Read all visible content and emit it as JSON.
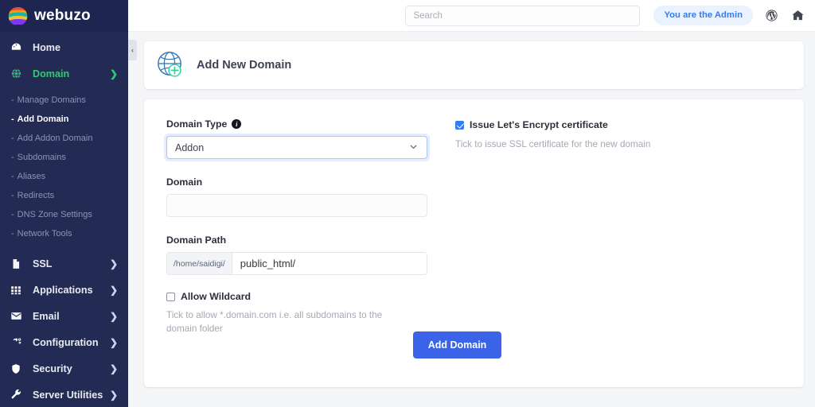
{
  "brand": {
    "name": "webuzo",
    "logo_icon": "webuzo-globe-logo"
  },
  "sidebar": {
    "primary": [
      {
        "label": "Home",
        "icon": "dashboard-gauge-icon",
        "has_chevron": false,
        "active": false
      },
      {
        "label": "Domain",
        "icon": "globe-icon",
        "has_chevron": true,
        "active": true
      }
    ],
    "sub_items": [
      {
        "label": "Manage Domains",
        "active": false
      },
      {
        "label": "Add Domain",
        "active": true
      },
      {
        "label": "Add Addon Domain",
        "active": false
      },
      {
        "label": "Subdomains",
        "active": false
      },
      {
        "label": "Aliases",
        "active": false
      },
      {
        "label": "Redirects",
        "active": false
      },
      {
        "label": "DNS Zone Settings",
        "active": false
      },
      {
        "label": "Network Tools",
        "active": false
      }
    ],
    "lower": [
      {
        "label": "SSL",
        "icon": "document-icon"
      },
      {
        "label": "Applications",
        "icon": "grid-apps-icon"
      },
      {
        "label": "Email",
        "icon": "envelope-icon"
      },
      {
        "label": "Configuration",
        "icon": "gears-icon"
      },
      {
        "label": "Security",
        "icon": "shield-icon"
      },
      {
        "label": "Server Utilities",
        "icon": "wrench-icon"
      }
    ],
    "collapse_glyph": "‹",
    "dash": "-"
  },
  "topbar": {
    "search_placeholder": "Search",
    "search_value": "",
    "admin_badge": "You are the Admin",
    "wordpress_icon": "wordpress-icon",
    "home_icon": "home-icon"
  },
  "page": {
    "title": "Add New Domain",
    "title_icon": "globe-plus-icon"
  },
  "form": {
    "domain_type": {
      "label": "Domain Type",
      "info_glyph": "i",
      "value": "Addon",
      "options": [
        "Addon"
      ],
      "chevron": "⌄"
    },
    "domain": {
      "label": "Domain",
      "value": "",
      "placeholder": ""
    },
    "domain_path": {
      "label": "Domain Path",
      "prefix": "/home/saidigi/",
      "value": "public_html/"
    },
    "allow_wildcard": {
      "label": "Allow Wildcard",
      "checked": false,
      "hint": "Tick to allow *.domain.com i.e. all subdomains to the domain folder"
    },
    "lets_encrypt": {
      "label": "Issue Let's Encrypt certificate",
      "checked": true,
      "hint": "Tick to issue SSL certificate for the new domain"
    },
    "submit_label": "Add Domain"
  },
  "colors": {
    "sidebar_bg": "#232b54",
    "accent_green": "#2ecc71",
    "primary_blue": "#3b63e8",
    "badge_blue": "#2f7cf6",
    "page_bg": "#f4f5f7"
  }
}
